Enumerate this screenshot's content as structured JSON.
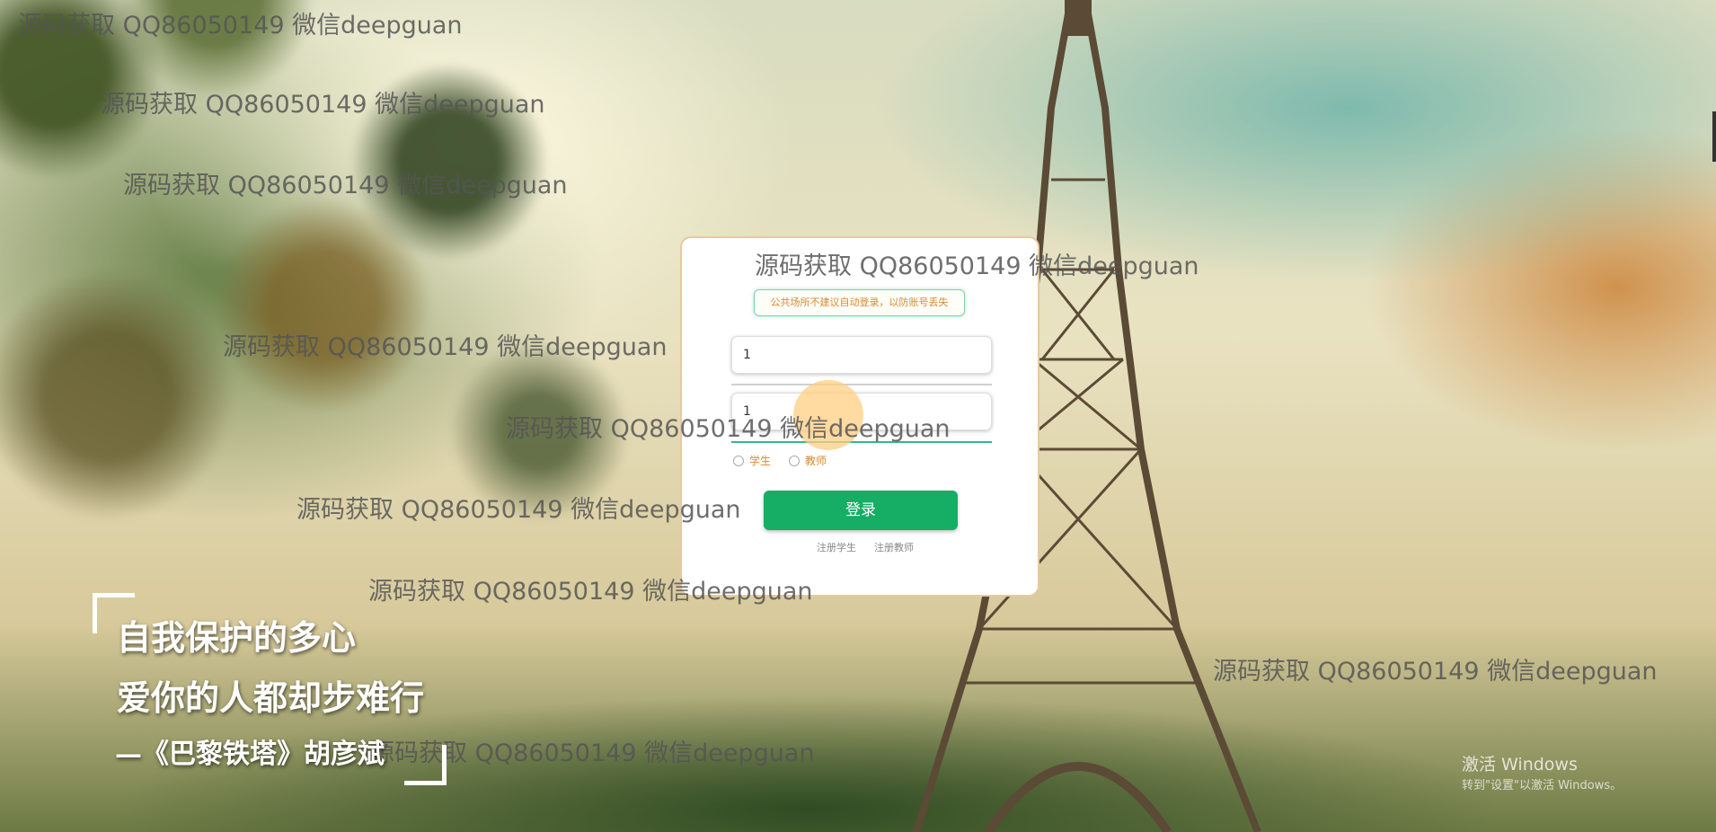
{
  "login": {
    "notice": "公共场所不建议自动登录，以防账号丢失",
    "username_value": "1",
    "password_value": "1",
    "role_student": "学生",
    "role_teacher": "教师",
    "login_button": "登录",
    "register_student": "注册学生",
    "register_teacher": "注册教师"
  },
  "poem": {
    "line1": "自我保护的多心",
    "line2": "爱你的人都却步难行",
    "line3": "—《巴黎铁塔》胡彦斌"
  },
  "watermark_text": "源码获取 QQ86050149 微信deepguan",
  "os": {
    "activate_title": "激活 Windows",
    "activate_sub": "转到\"设置\"以激活 Windows。"
  },
  "colors": {
    "accent_green": "#16ad64",
    "notice_orange": "#d98a2f"
  }
}
